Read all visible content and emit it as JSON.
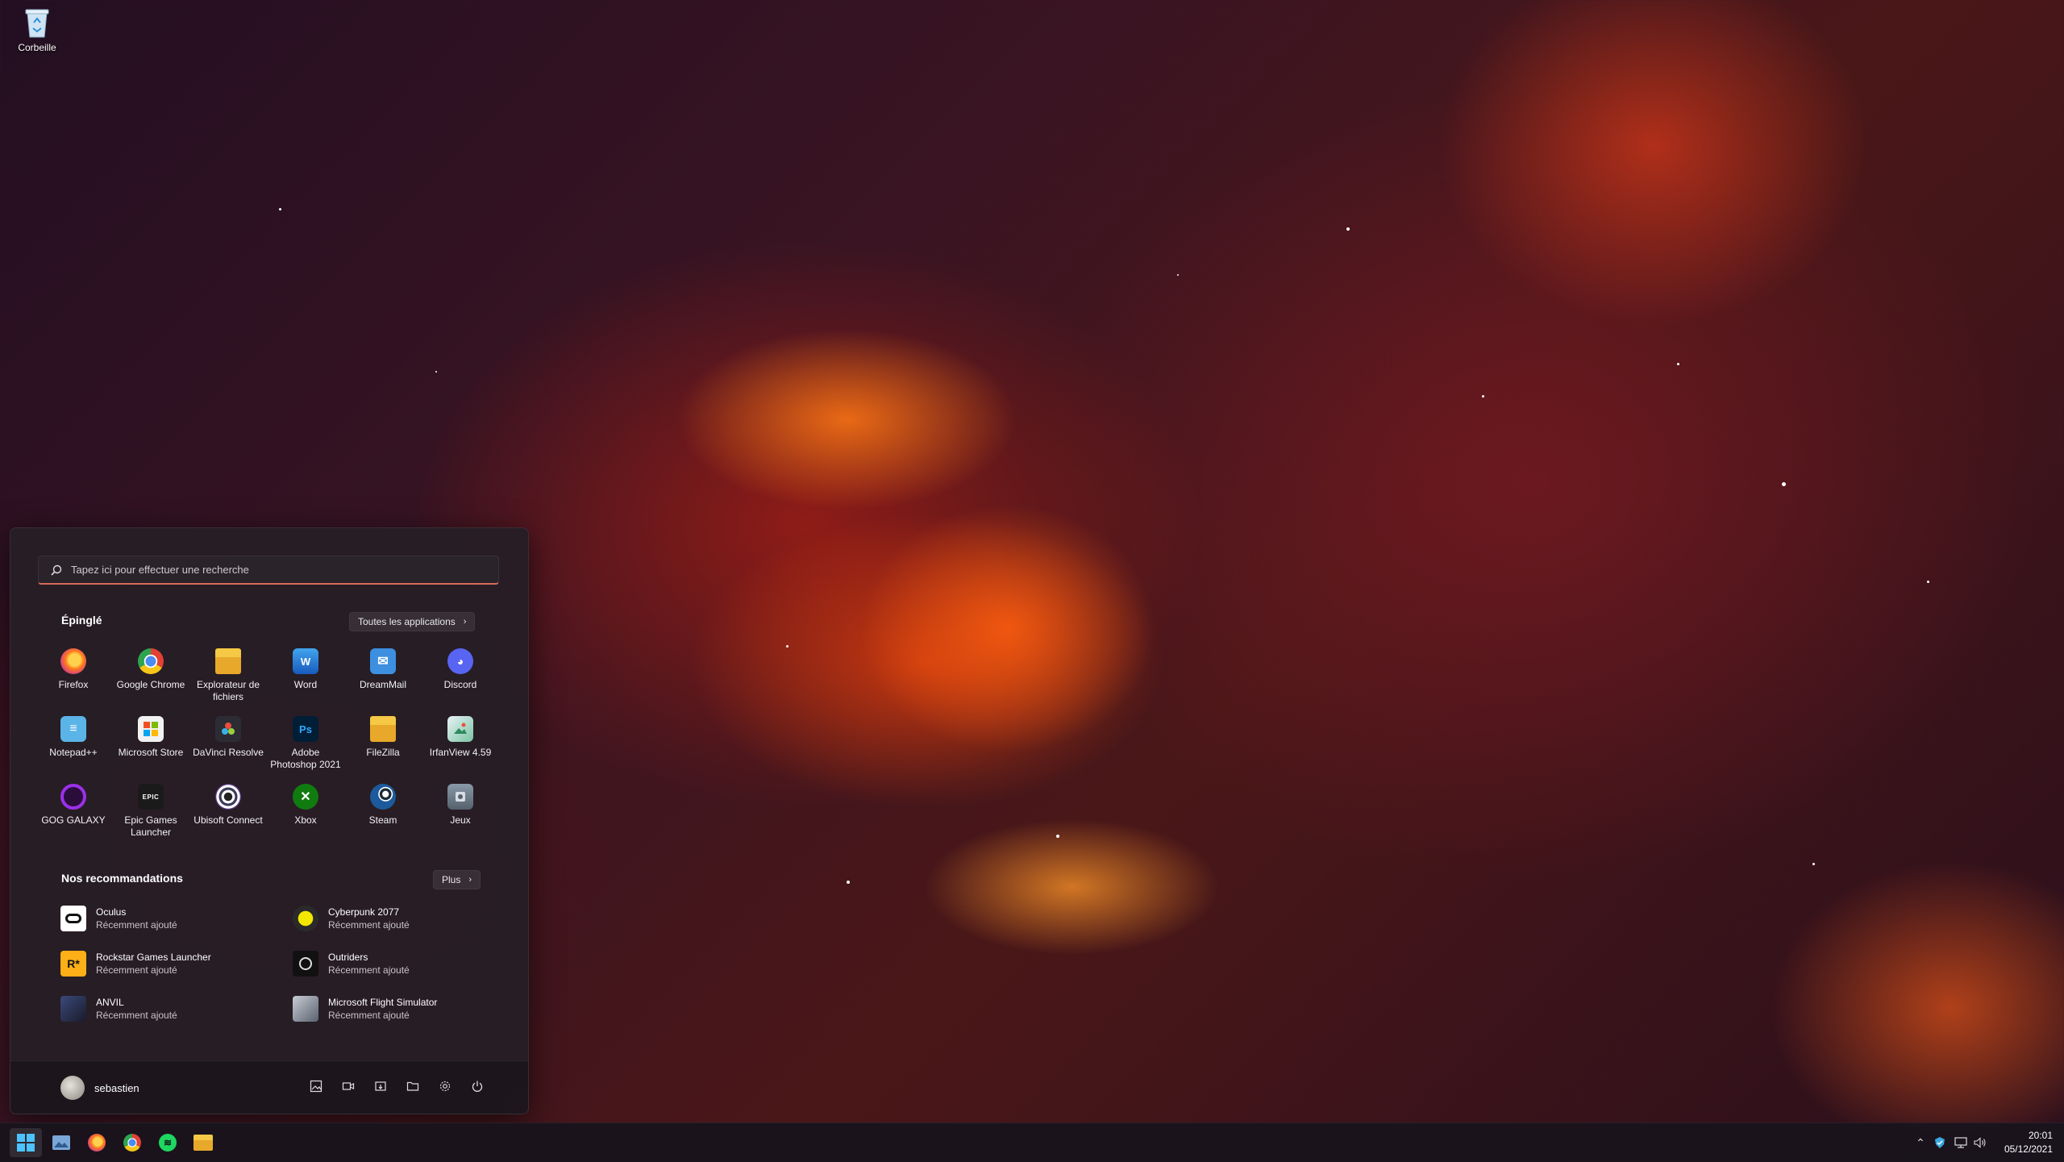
{
  "desktop": {
    "icons": [
      {
        "label": "Corbeille",
        "icon": "recycle-bin-icon"
      }
    ]
  },
  "start_menu": {
    "search_placeholder": "Tapez ici pour effectuer une recherche",
    "pinned_title": "Épinglé",
    "all_apps_label": "Toutes les applications",
    "pinned_apps": [
      {
        "label": "Firefox",
        "icon": "firefox-icon"
      },
      {
        "label": "Google Chrome",
        "icon": "chrome-icon"
      },
      {
        "label": "Explorateur de fichiers",
        "icon": "file-explorer-icon"
      },
      {
        "label": "Word",
        "icon": "word-icon"
      },
      {
        "label": "DreamMail",
        "icon": "dreammail-icon"
      },
      {
        "label": "Discord",
        "icon": "discord-icon"
      },
      {
        "label": "Notepad++",
        "icon": "notepad-plus-plus-icon"
      },
      {
        "label": "Microsoft Store",
        "icon": "microsoft-store-icon"
      },
      {
        "label": "DaVinci Resolve",
        "icon": "davinci-resolve-icon"
      },
      {
        "label": "Adobe Photoshop 2021",
        "icon": "photoshop-icon"
      },
      {
        "label": "FileZilla",
        "icon": "filezilla-icon"
      },
      {
        "label": "IrfanView 4.59",
        "icon": "irfanview-icon"
      },
      {
        "label": "GOG GALAXY",
        "icon": "gog-galaxy-icon"
      },
      {
        "label": "Epic Games Launcher",
        "icon": "epic-games-icon"
      },
      {
        "label": "Ubisoft Connect",
        "icon": "ubisoft-connect-icon"
      },
      {
        "label": "Xbox",
        "icon": "xbox-icon"
      },
      {
        "label": "Steam",
        "icon": "steam-icon"
      },
      {
        "label": "Jeux",
        "icon": "games-folder-icon"
      }
    ],
    "recommended_title": "Nos recommandations",
    "more_label": "Plus",
    "recommended": [
      {
        "name": "Oculus",
        "sub": "Récemment ajouté",
        "icon": "oculus-icon"
      },
      {
        "name": "Cyberpunk 2077",
        "sub": "Récemment ajouté",
        "icon": "cyberpunk-icon"
      },
      {
        "name": "Rockstar Games Launcher",
        "sub": "Récemment ajouté",
        "icon": "rockstar-icon"
      },
      {
        "name": "Outriders",
        "sub": "Récemment ajouté",
        "icon": "outriders-icon"
      },
      {
        "name": "ANVIL",
        "sub": "Récemment ajouté",
        "icon": "anvil-icon"
      },
      {
        "name": "Microsoft Flight Simulator",
        "sub": "Récemment ajouté",
        "icon": "flight-simulator-icon"
      }
    ],
    "user_name": "sebastien",
    "footer_buttons": [
      "pictures-icon",
      "videos-icon",
      "documents-icon",
      "file-explorer-icon",
      "settings-icon",
      "power-icon"
    ]
  },
  "taskbar": {
    "apps": [
      "windows-start-icon",
      "photos-icon",
      "firefox-icon",
      "chrome-icon",
      "spotify-icon",
      "file-explorer-icon"
    ],
    "tray": [
      "chevron-up-icon",
      "security-icon",
      "network-icon",
      "volume-icon"
    ],
    "time": "20:01",
    "date": "05/12/2021"
  },
  "colors": {
    "accent": "#d86a5a",
    "start_bg": "#261e26",
    "taskbar_bg": "#19141c"
  }
}
